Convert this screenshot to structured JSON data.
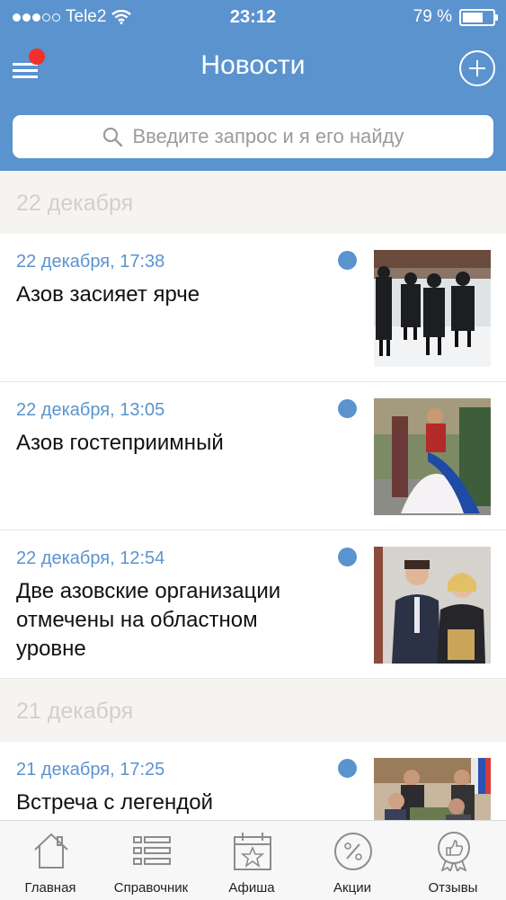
{
  "status": {
    "carrier": "Tele2",
    "time": "23:12",
    "battery": "79 %",
    "battery_level": 0.79
  },
  "header": {
    "title": "Новости"
  },
  "search": {
    "placeholder": "Введите запрос и я его найду"
  },
  "sections": [
    {
      "label": "22 декабря"
    },
    {
      "label": "21 декабря"
    }
  ],
  "news": [
    {
      "date": "22 декабря, 17:38",
      "title": "Азов засияет ярче",
      "unread": true
    },
    {
      "date": "22 декабря, 13:05",
      "title": "Азов гостеприимный",
      "unread": true
    },
    {
      "date": "22 декабря, 12:54",
      "title": "Две азовские организации отмечены на областном уровне",
      "unread": true
    },
    {
      "date": "21 декабря, 17:25",
      "title": "Встреча с легендой",
      "unread": true
    }
  ],
  "tabs": [
    {
      "label": "Главная",
      "icon": "home-icon"
    },
    {
      "label": "Справочник",
      "icon": "list-icon"
    },
    {
      "label": "Афиша",
      "icon": "calendar-star-icon"
    },
    {
      "label": "Акции",
      "icon": "percent-icon"
    },
    {
      "label": "Отзывы",
      "icon": "thumbs-up-badge-icon"
    }
  ],
  "colors": {
    "accent": "#5b93cf",
    "badge": "#f2302b",
    "section_bg": "#f6f4f1"
  }
}
